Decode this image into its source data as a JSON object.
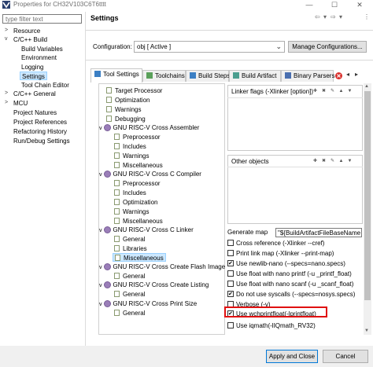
{
  "window": {
    "title": "Properties for CH32V103C6T6tttt",
    "controls": [
      "—",
      "☐",
      "✕"
    ]
  },
  "nav": {
    "filter_placeholder": "type filter text",
    "items": [
      {
        "label": "Resource",
        "arrow": ">"
      },
      {
        "label": "C/C++ Build",
        "arrow": "v"
      },
      {
        "label": "Build Variables"
      },
      {
        "label": "Environment"
      },
      {
        "label": "Logging"
      },
      {
        "label": "Settings",
        "selected": true
      },
      {
        "label": "Tool Chain Editor"
      },
      {
        "label": "C/C++ General",
        "arrow": ">"
      },
      {
        "label": "MCU",
        "arrow": ">"
      },
      {
        "label": "Project Natures"
      },
      {
        "label": "Project References"
      },
      {
        "label": "Refactoring History"
      },
      {
        "label": "Run/Debug Settings"
      }
    ]
  },
  "settings": {
    "title": "Settings",
    "nav_arrows": [
      "⇦",
      "▾",
      "⇨",
      "▾",
      "⋮"
    ],
    "configuration_label": "Configuration:",
    "configuration_value": "obj  [ Active ]",
    "manage_button": "Manage Configurations..."
  },
  "tabs": [
    {
      "label": "Tool Settings",
      "active": true
    },
    {
      "label": "Toolchains"
    },
    {
      "label": "Build Steps"
    },
    {
      "label": "Build Artifact"
    },
    {
      "label": "Binary Parsers"
    }
  ],
  "tree": [
    {
      "label": "Target Processor",
      "level": 1
    },
    {
      "label": "Optimization",
      "level": 1
    },
    {
      "label": "Warnings",
      "level": 1
    },
    {
      "label": "Debugging",
      "level": 1
    },
    {
      "label": "GNU RISC-V Cross Assembler",
      "level": 0
    },
    {
      "label": "Preprocessor",
      "level": 1
    },
    {
      "label": "Includes",
      "level": 1
    },
    {
      "label": "Warnings",
      "level": 1
    },
    {
      "label": "Miscellaneous",
      "level": 1
    },
    {
      "label": "GNU RISC-V Cross C Compiler",
      "level": 0
    },
    {
      "label": "Preprocessor",
      "level": 1
    },
    {
      "label": "Includes",
      "level": 1
    },
    {
      "label": "Optimization",
      "level": 1
    },
    {
      "label": "Warnings",
      "level": 1
    },
    {
      "label": "Miscellaneous",
      "level": 1
    },
    {
      "label": "GNU RISC-V Cross C Linker",
      "level": 0
    },
    {
      "label": "General",
      "level": 1
    },
    {
      "label": "Libraries",
      "level": 1
    },
    {
      "label": "Miscellaneous",
      "level": 1,
      "selected": true
    },
    {
      "label": "GNU RISC-V Cross Create Flash Image",
      "level": 0
    },
    {
      "label": "General",
      "level": 1
    },
    {
      "label": "GNU RISC-V Cross Create Listing",
      "level": 0
    },
    {
      "label": "General",
      "level": 1
    },
    {
      "label": "GNU RISC-V Cross Print Size",
      "level": 0
    },
    {
      "label": "General",
      "level": 1
    }
  ],
  "linker_flags": {
    "label": "Linker flags (-Xlinker [option])",
    "value": ""
  },
  "other_objects": {
    "label": "Other objects"
  },
  "generate_map": {
    "label": "Generate map",
    "value": "\"${BuildArtifactFileBaseName"
  },
  "options": [
    {
      "label": "Cross reference (-Xlinker --cref)",
      "checked": false
    },
    {
      "label": "Print link map (-Xlinker --print-map)",
      "checked": false
    },
    {
      "label": "Use newlib-nano (--specs=nano.specs)",
      "checked": true
    },
    {
      "label": "Use float with nano printf (-u _printf_float)",
      "checked": false
    },
    {
      "label": "Use float with nano scanf (-u _scanf_float)",
      "checked": false
    },
    {
      "label": "Do not use syscalls (--specs=nosys.specs)",
      "checked": true
    },
    {
      "label": "Verbose (-v)",
      "checked": false
    },
    {
      "label": "Use wchprintfloat(-lprintfloat)",
      "checked": true
    },
    {
      "label": "Use iqmath(-lIQmath_RV32)",
      "checked": false
    }
  ],
  "footer": {
    "apply_close": "Apply and Close",
    "cancel": "Cancel"
  },
  "colors": {
    "highlight": "#e01010",
    "selection": "#cce8ff",
    "accent": "#0078d7"
  }
}
